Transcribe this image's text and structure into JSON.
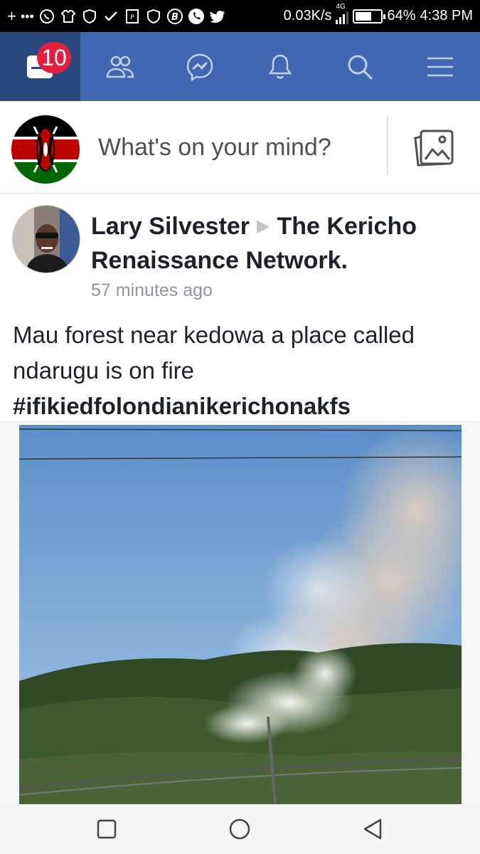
{
  "status_bar": {
    "speed": "0.03K/s",
    "network": "4G",
    "battery_pct": "64%",
    "battery_level": 0.64,
    "time": "4:38 PM",
    "left_icons": [
      "plus-icon",
      "more-dots-icon",
      "whatsapp-icon",
      "shirt-icon",
      "shield-icon",
      "check-icon",
      "pdf-icon",
      "shield-icon",
      "b-app-icon",
      "phone-icon",
      "twitter-icon"
    ]
  },
  "nav": {
    "notification_count": "10",
    "tabs": [
      "news-feed-icon",
      "friends-icon",
      "messenger-icon",
      "notifications-icon",
      "search-icon",
      "menu-icon"
    ]
  },
  "composer": {
    "placeholder": "What's on your mind?"
  },
  "post": {
    "author": "Lary Silvester",
    "group": "The Kericho Renaissance Network.",
    "time": "57 minutes ago",
    "text": "Mau forest near kedowa a place called ndarugu is on fire",
    "hashtag": "#ifikiedfolondianikerichonakfs"
  },
  "colors": {
    "brand": "#4267b2",
    "brand_active": "#29487d",
    "badge": "#e41e3f"
  }
}
